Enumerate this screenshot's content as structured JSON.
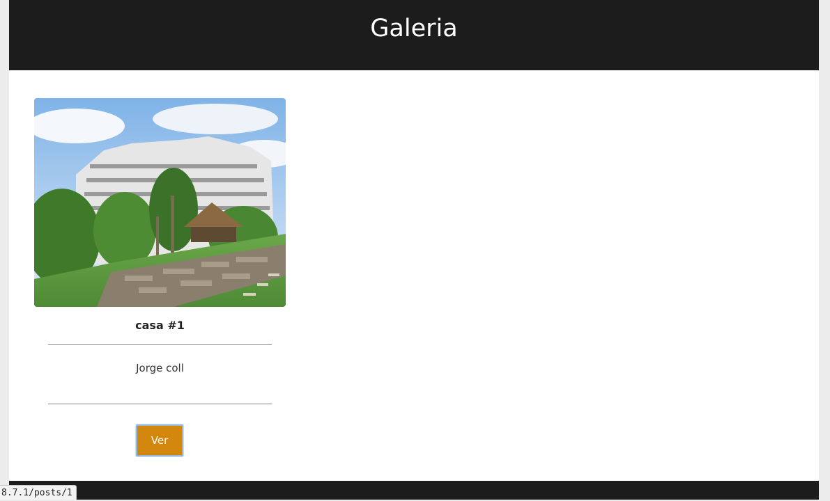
{
  "header": {
    "title": "Galeria"
  },
  "gallery": {
    "items": [
      {
        "title": "casa #1",
        "author": "Jorge coll",
        "button_label": "Ver"
      }
    ]
  },
  "status_bar": {
    "url": "8.7.1/posts/1"
  },
  "colors": {
    "header_bg": "#1c1c1d",
    "button_bg": "#d4870f",
    "page_bg": "#ffffff"
  }
}
